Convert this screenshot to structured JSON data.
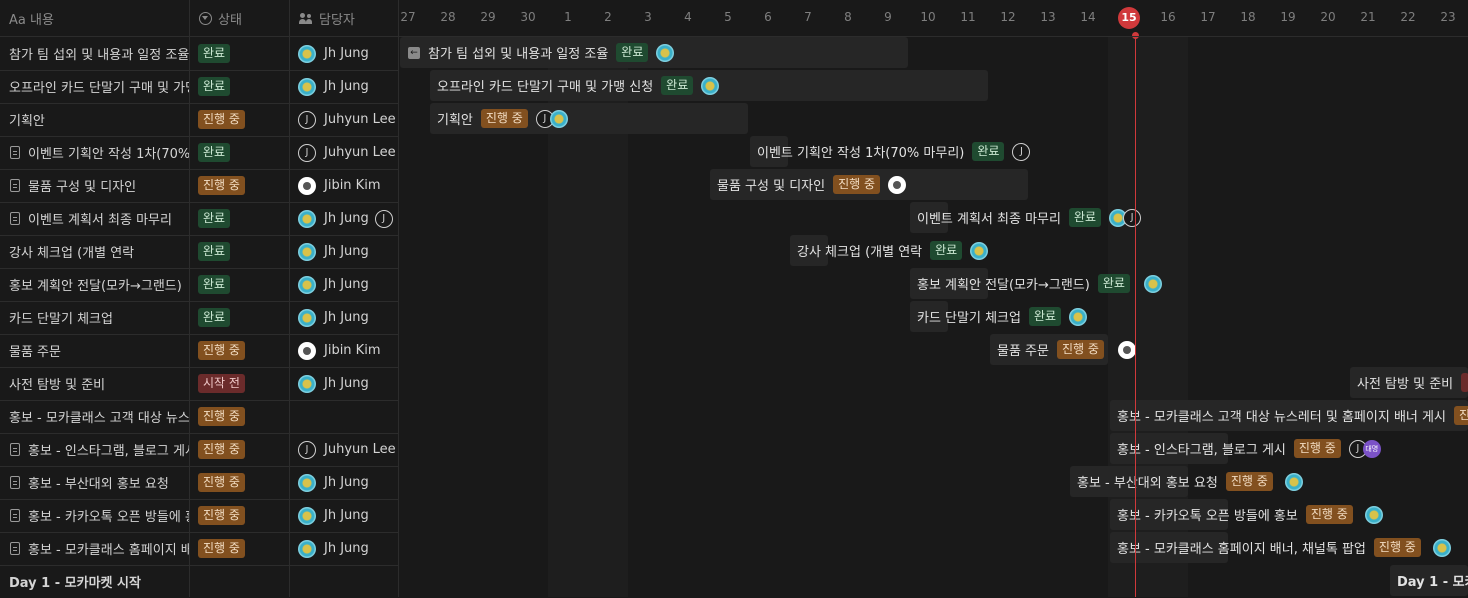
{
  "columns": {
    "title": "Aa 내용",
    "status": "상태",
    "assignee": "담당자"
  },
  "days": [
    "27",
    "28",
    "29",
    "30",
    "1",
    "2",
    "3",
    "4",
    "5",
    "6",
    "7",
    "8",
    "9",
    "10",
    "11",
    "12",
    "13",
    "14",
    "15",
    "16",
    "17",
    "18",
    "19",
    "20",
    "21",
    "22",
    "23"
  ],
  "today": "15",
  "rows": [
    {
      "title": "참가 팀 섭외 및 내용과 일정 조율",
      "status": "완료",
      "assignee": "Jh Jung"
    },
    {
      "title": "오프라인 카드 단말기 구매 및 가맹 신청",
      "status": "완료",
      "assignee": "Jh Jung"
    },
    {
      "title": "기획안",
      "status": "진행 중",
      "assignee": "Juhyun Lee"
    },
    {
      "title": "이벤트 기획안 작성 1차(70% 마무리)",
      "status": "완료",
      "assignee": "Juhyun Lee"
    },
    {
      "title": "물품 구성 및 디자인",
      "status": "진행 중",
      "assignee": "Jibin Kim"
    },
    {
      "title": "이벤트 계획서 최종 마무리",
      "status": "완료",
      "assignee": "Jh Jung"
    },
    {
      "title": "강사 체크업 (개별 연락",
      "status": "완료",
      "assignee": "Jh Jung"
    },
    {
      "title": "홍보 계획안 전달(모카→그랜드)",
      "status": "완료",
      "assignee": "Jh Jung"
    },
    {
      "title": "카드 단말기 체크업",
      "status": "완료",
      "assignee": "Jh Jung"
    },
    {
      "title": "물품 주문",
      "status": "진행 중",
      "assignee": "Jibin Kim"
    },
    {
      "title": "사전 탐방 및 준비",
      "status": "시작 전",
      "assignee": "Jh Jung"
    },
    {
      "title": "홍보 - 모카클래스 고객 대상 뉴스레터 및 홈페이지 배너 게시",
      "status": "진행 중",
      "assignee": ""
    },
    {
      "title": "홍보 - 인스타그램, 블로그 게시",
      "status": "진행 중",
      "assignee": "Juhyun Lee"
    },
    {
      "title": "홍보 - 부산대외 홍보 요청",
      "status": "진행 중",
      "assignee": "Jh Jung"
    },
    {
      "title": "홍보 - 카카오톡 오픈 방들에 홍보",
      "status": "진행 중",
      "assignee": "Jh Jung"
    },
    {
      "title": "홍보 - 모카클래스 홈페이지 배너, 채널톡 팝업",
      "status": "진행 중",
      "assignee": "Jh Jung"
    },
    {
      "title": "Day 1 - 모카마켓 시작",
      "status": "",
      "assignee": ""
    }
  ],
  "timeline_extra": {
    "row3_initial": "J",
    "row6_initial": "J",
    "row13_initial": "J",
    "row13_badge": "대명",
    "row17_bar": "Day 1 - 모카"
  },
  "colors": {
    "background": "#191919",
    "today": "#d0393b",
    "done": "#1f4a30",
    "in_progress": "#82501f",
    "not_started": "#6b2b2b"
  }
}
